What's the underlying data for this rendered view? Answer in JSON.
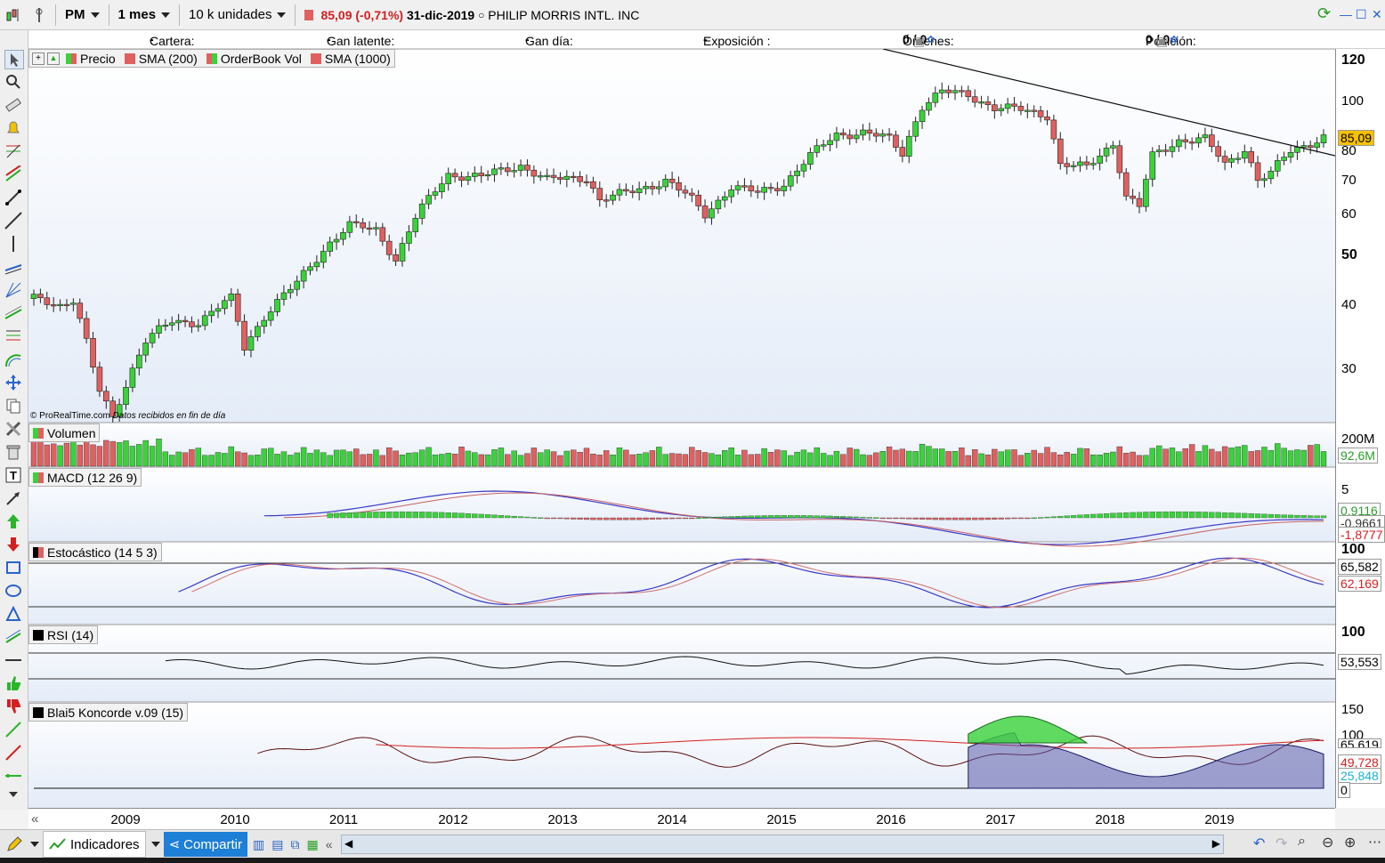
{
  "toolbar": {
    "ticker": "PM",
    "interval": "1 mes",
    "units": "10 k unidades",
    "price_change": "85,09 (-0,71%)",
    "date": "31-dic-2019",
    "instrument": "PHILIP MORRIS INTL. INC"
  },
  "infobar": {
    "cartera_label": "Cartera:",
    "cartera_value": "-",
    "gan_latente_label": "Gan latente:",
    "gan_latente_value": "-",
    "gan_dia_label": "Gan día:",
    "gan_dia_value": "-",
    "exposicion_label": "Exposición :",
    "exposicion_value": "-",
    "ordenes_label": "Órdenes:",
    "ordenes_value_1": "0",
    "ordenes_value_2": "/ 0",
    "posicion_label": "Posición:",
    "posicion_value_1": "0",
    "posicion_value_2": "/ 0"
  },
  "price_panel": {
    "legend": [
      "Precio",
      "SMA (200)",
      "OrderBook Vol",
      "SMA (1000)"
    ],
    "credit": "© ProRealTime.com",
    "credit_note": "Datos recibidos en fin de día",
    "y_ticks": [
      "120",
      "100",
      "80",
      "70",
      "60",
      "50",
      "40",
      "30"
    ],
    "last_price": "85,09",
    "colors": {
      "up": "#3ad23a",
      "down": "#e06060",
      "last_box": "#f5c000"
    }
  },
  "volume_panel": {
    "legend": "Volumen",
    "y_tick": "200M",
    "last_value": "92,6M"
  },
  "macd_panel": {
    "legend": "MACD (12 26 9)",
    "y_tick": "5",
    "values": [
      "0,9116",
      "-0,9661",
      "-1,8777"
    ]
  },
  "stoch_panel": {
    "legend": "Estocástico (14 5 3)",
    "y_tick": "100",
    "values": [
      "65,582",
      "62,169"
    ]
  },
  "rsi_panel": {
    "legend": "RSI (14)",
    "y_tick": "100",
    "value": "53,553"
  },
  "koncorde_panel": {
    "legend": "Blai5 Koncorde v.09 (15)",
    "y_ticks": [
      "150",
      "100",
      "0"
    ],
    "values": [
      "65,619",
      "49,728",
      "25,848"
    ]
  },
  "x_axis": {
    "years": [
      "2009",
      "2010",
      "2011",
      "2012",
      "2013",
      "2014",
      "2015",
      "2016",
      "2017",
      "2018",
      "2019"
    ]
  },
  "bottombar": {
    "indicadores": "Indicadores",
    "compartir": "Compartir"
  },
  "chart_data": {
    "type": "candlestick",
    "title": "PHILIP MORRIS INTL. INC",
    "interval": "monthly",
    "x_range": [
      "2008-07",
      "2019-12"
    ],
    "y_scale": "log",
    "y_range": [
      25,
      125
    ],
    "ohlc": []
  }
}
